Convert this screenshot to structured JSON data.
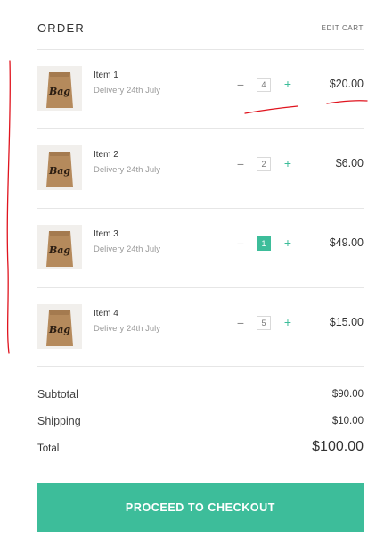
{
  "header": {
    "title": "ORDER",
    "edit_cart_label": "EDIT CART"
  },
  "items": [
    {
      "name": "Item 1",
      "delivery": "Delivery 24th July",
      "quantity": "4",
      "price": "$20.00",
      "quantity_active": false,
      "bag_text": "Bag"
    },
    {
      "name": "Item 2",
      "delivery": "Delivery 24th July",
      "quantity": "2",
      "price": "$6.00",
      "quantity_active": false,
      "bag_text": "Bag"
    },
    {
      "name": "Item 3",
      "delivery": "Delivery 24th July",
      "quantity": "1",
      "price": "$49.00",
      "quantity_active": true,
      "bag_text": "Bag"
    },
    {
      "name": "Item 4",
      "delivery": "Delivery 24th July",
      "quantity": "5",
      "price": "$15.00",
      "quantity_active": false,
      "bag_text": "Bag"
    }
  ],
  "controls": {
    "minus_symbol": "−",
    "plus_symbol": "+"
  },
  "summary": {
    "subtotal_label": "Subtotal",
    "subtotal_value": "$90.00",
    "shipping_label": "Shipping",
    "shipping_value": "$10.00",
    "total_label": "Total",
    "total_value": "$100.00"
  },
  "checkout": {
    "label": "PROCEED TO CHECKOUT"
  },
  "colors": {
    "accent": "#3dbd9a",
    "annotation": "#e0141e",
    "bag": "#b58a5c"
  },
  "icons": {
    "product_image": "kraft-paper-bag-icon",
    "decrement": "minus-icon",
    "increment": "plus-icon"
  }
}
